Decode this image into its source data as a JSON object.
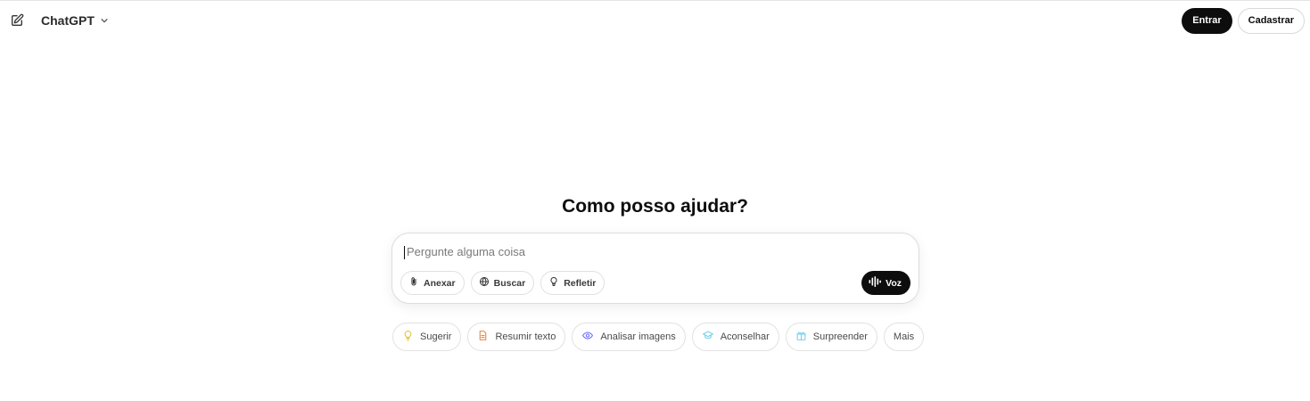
{
  "header": {
    "model_name": "ChatGPT",
    "login_label": "Entrar",
    "signup_label": "Cadastrar",
    "icons": [
      "new-chat-icon",
      "chevron-down-icon"
    ]
  },
  "hero": {
    "headline": "Como posso ajudar?"
  },
  "composer": {
    "placeholder": "Pergunte alguma coisa",
    "value": "",
    "tools": [
      {
        "label": "Anexar",
        "icon": "paperclip-icon"
      },
      {
        "label": "Buscar",
        "icon": "globe-icon"
      },
      {
        "label": "Refletir",
        "icon": "lightbulb-icon"
      }
    ],
    "voice_label": "Voz",
    "voice_icon": "waveform-icon"
  },
  "suggestions": [
    {
      "label": "Sugerir",
      "icon": "lightbulb-icon",
      "color": "#e2c541"
    },
    {
      "label": "Resumir texto",
      "icon": "document-icon",
      "color": "#ea8444"
    },
    {
      "label": "Analisar imagens",
      "icon": "eye-icon",
      "color": "#6c71ff"
    },
    {
      "label": "Aconselhar",
      "icon": "graduation-cap-icon",
      "color": "#76d0eb"
    },
    {
      "label": "Surpreender",
      "icon": "gift-icon",
      "color": "#76d0eb"
    },
    {
      "label": "Mais",
      "icon": "",
      "color": ""
    }
  ],
  "colors": {
    "primary_button": "#0d0d0d",
    "border": "#e2e2e2",
    "text": "#0d0d0d"
  }
}
